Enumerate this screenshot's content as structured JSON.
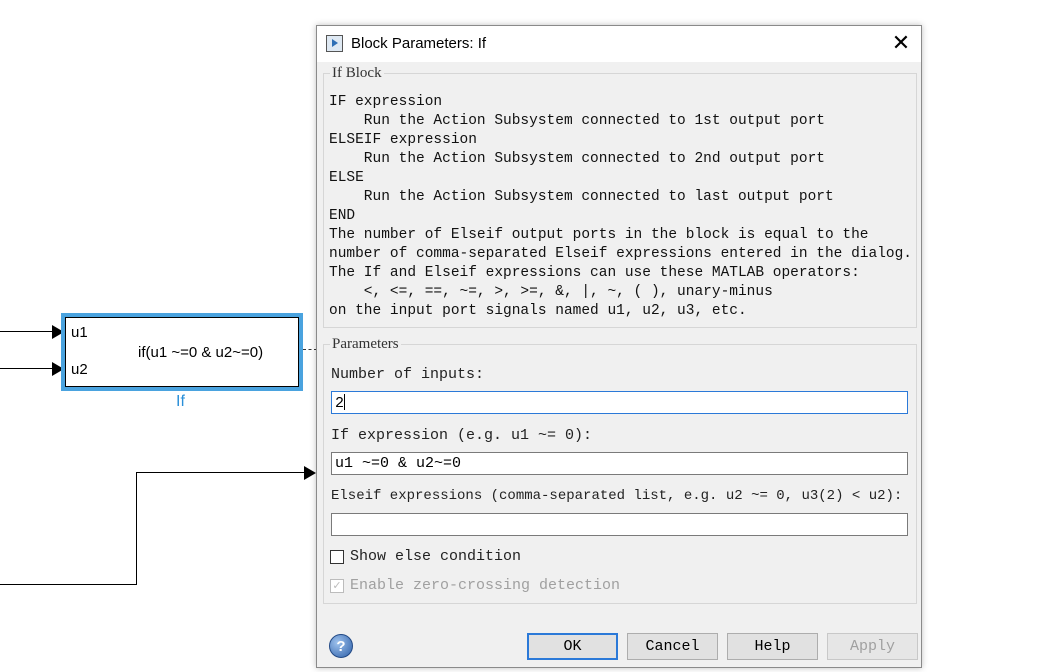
{
  "canvas": {
    "block": {
      "port1": "u1",
      "port2": "u2",
      "expression": "if(u1 ~=0 & u2~=0)",
      "name": "If"
    }
  },
  "dialog": {
    "title": "Block Parameters: If",
    "close_icon": "close-icon",
    "description": {
      "group_label": "If Block",
      "text": "IF expression\n    Run the Action Subsystem connected to 1st output port\nELSEIF expression\n    Run the Action Subsystem connected to 2nd output port\nELSE\n    Run the Action Subsystem connected to last output port\nEND\nThe number of Elseif output ports in the block is equal to the\nnumber of comma-separated Elseif expressions entered in the dialog.\nThe If and Elseif expressions can use these MATLAB operators:\n    <, <=, ==, ~=, >, >=, &, |, ~, ( ), unary-minus\non the input port signals named u1, u2, u3, etc."
    },
    "parameters": {
      "group_label": "Parameters",
      "num_inputs_label": "Number of inputs:",
      "num_inputs_value": "2",
      "if_expr_label": "If expression (e.g. u1 ~= 0):",
      "if_expr_value": "u1 ~=0 & u2~=0",
      "elseif_label": "Elseif expressions (comma-separated list, e.g. u2 ~= 0, u3(2) < u2):",
      "elseif_value": "",
      "show_else_label": "Show else condition",
      "show_else_checked": false,
      "zero_crossing_label": "Enable zero-crossing detection",
      "zero_crossing_checked": true,
      "zero_crossing_enabled": false
    },
    "buttons": {
      "ok": "OK",
      "cancel": "Cancel",
      "help": "Help",
      "apply": "Apply"
    }
  }
}
